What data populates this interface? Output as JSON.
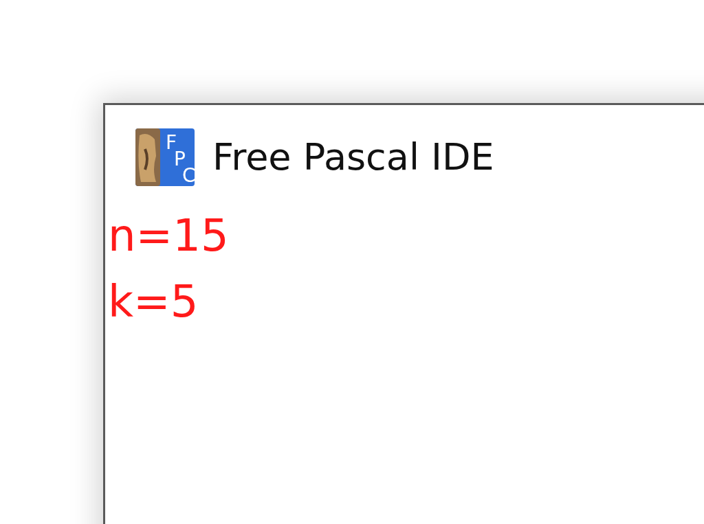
{
  "window": {
    "title": "Free Pascal IDE",
    "icon_letters": "FPC"
  },
  "console": {
    "lines": [
      "n=15",
      "k=5"
    ]
  }
}
